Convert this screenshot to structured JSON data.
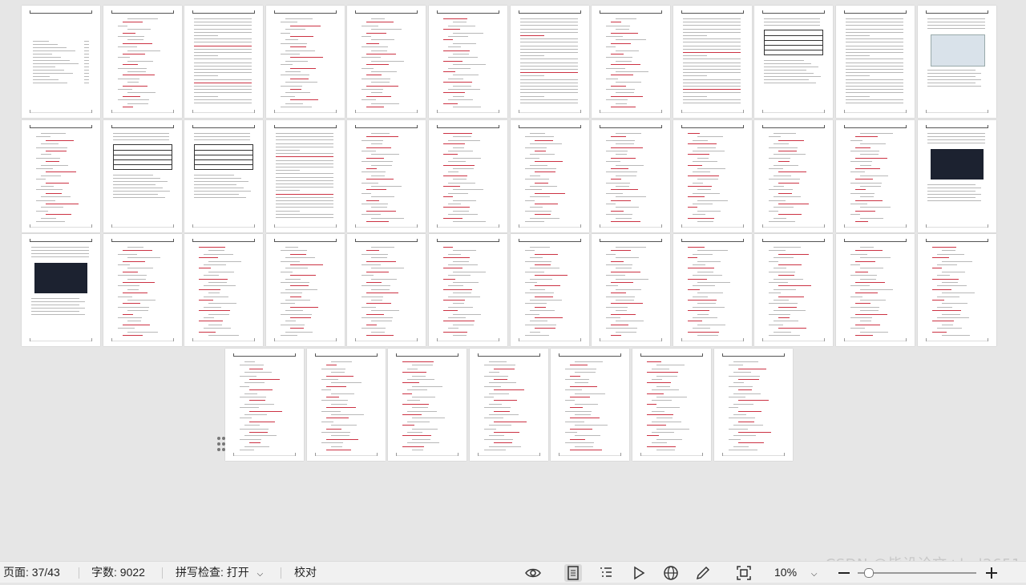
{
  "status": {
    "page_label": "页面: 37/43",
    "words_label": "字数: 9022",
    "spell_label": "拼写检查: 打开",
    "proof_label": "校对",
    "zoom_label": "10%"
  },
  "watermark": "CSDN @毕设论文+hal2651",
  "icons": {
    "reading": "eye-icon",
    "page_view": "page-view-icon",
    "outline": "outline-icon",
    "play": "play-icon",
    "web": "globe-icon",
    "pen": "pen-icon",
    "fit": "fit-window-icon",
    "zoom_out": "minus-icon",
    "zoom_in": "plus-icon"
  },
  "colors": {
    "background": "#e6e6e6",
    "statusbar": "#f1f1f1",
    "spell_underline": "#cc3344"
  },
  "pages": {
    "total": 43,
    "current": 37,
    "rows": [
      12,
      12,
      12,
      7
    ]
  }
}
